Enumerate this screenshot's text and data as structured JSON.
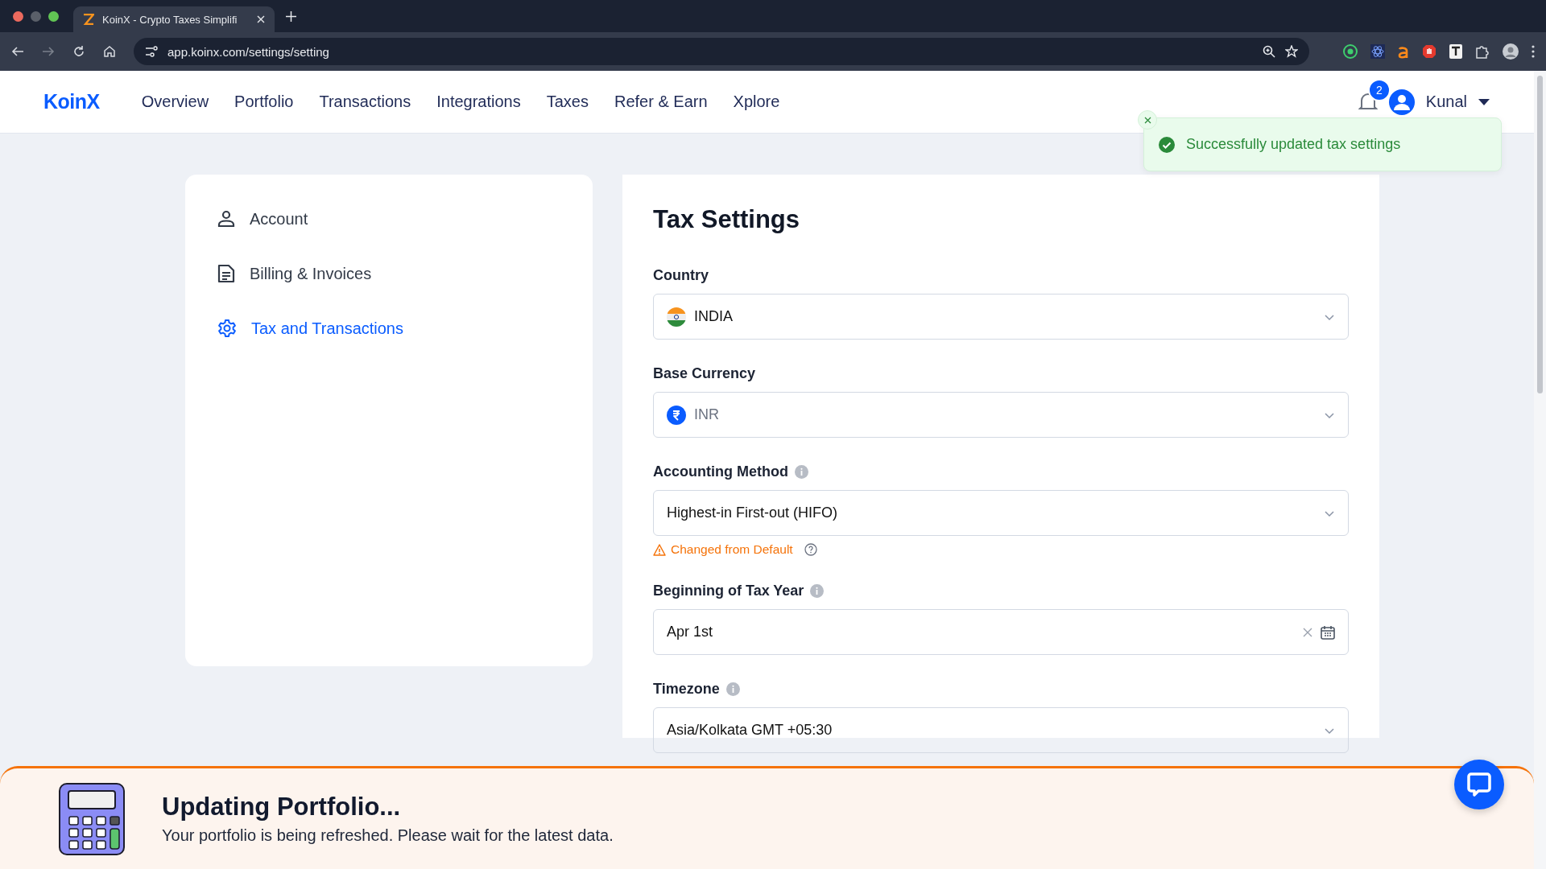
{
  "browser": {
    "tab": {
      "title": "KoinX - Crypto Taxes Simplifi"
    },
    "url": "app.koinx.com/settings/setting"
  },
  "header": {
    "logo": "KoinX",
    "nav": [
      {
        "label": "Overview",
        "selected": false
      },
      {
        "label": "Portfolio",
        "selected": false
      },
      {
        "label": "Transactions",
        "selected": false
      },
      {
        "label": "Integrations",
        "selected": false
      },
      {
        "label": "Taxes",
        "selected": false
      },
      {
        "label": "Refer & Earn",
        "selected": false
      },
      {
        "label": "Xplore",
        "selected": false
      }
    ],
    "notification_count": "2",
    "user": "Kunal"
  },
  "toast": {
    "message": "Successfully updated tax settings"
  },
  "sidebar": {
    "items": [
      {
        "label": "Account",
        "kind": "person",
        "selected": false
      },
      {
        "label": "Billing & Invoices",
        "kind": "document",
        "selected": false
      },
      {
        "label": "Tax and Transactions",
        "kind": "gear",
        "selected": true
      }
    ]
  },
  "settings": {
    "title": "Tax Settings",
    "fields": [
      {
        "label": "Country",
        "info": false,
        "kind": "country",
        "value": "INDIA",
        "disabled": false
      },
      {
        "label": "Base Currency",
        "info": false,
        "kind": "currency",
        "value": "INR",
        "disabled": true
      },
      {
        "label": "Accounting Method",
        "info": true,
        "kind": "select",
        "value": "Highest-in First-out (HIFO)",
        "disabled": false,
        "warning": "Changed from Default"
      },
      {
        "label": "Beginning of Tax Year",
        "info": true,
        "kind": "date",
        "value": "Apr 1st",
        "disabled": false
      },
      {
        "label": "Timezone",
        "info": true,
        "kind": "select",
        "value": "Asia/Kolkata GMT +05:30",
        "disabled": false
      }
    ]
  },
  "banner": {
    "title": "Updating Portfolio...",
    "message": "Your portfolio is being refreshed. Please wait for the latest data."
  }
}
